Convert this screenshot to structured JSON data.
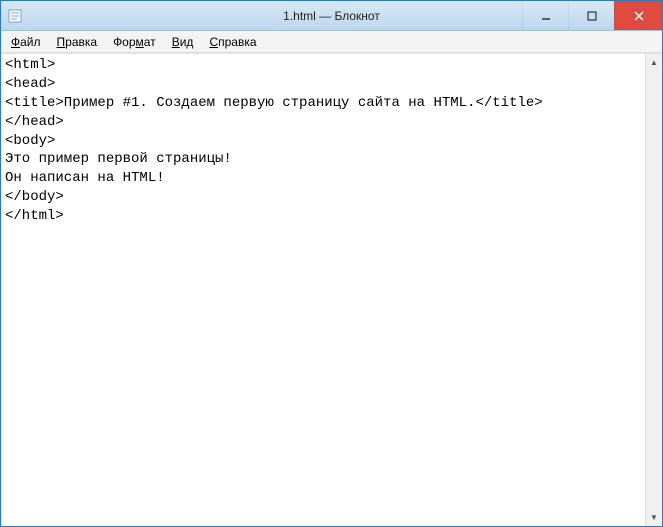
{
  "titlebar": {
    "title": "1.html — Блокнот"
  },
  "window_controls": {
    "minimize_label": "Minimize",
    "maximize_label": "Maximize",
    "close_label": "Close"
  },
  "menubar": {
    "file": {
      "label": "Файл",
      "hotkey_index": 0
    },
    "edit": {
      "label": "Правка",
      "hotkey_index": 0
    },
    "format": {
      "label": "Формат",
      "hotkey_index": 3
    },
    "view": {
      "label": "Вид",
      "hotkey_index": 0
    },
    "help": {
      "label": "Справка",
      "hotkey_index": 0
    }
  },
  "editor": {
    "content": "<html>\n<head>\n<title>Пример #1. Создаем первую страницу сайта на HTML.</title>\n</head>\n<body>\nЭто пример первой страницы!\nОн написан на HTML!\n</body>\n</html>"
  }
}
